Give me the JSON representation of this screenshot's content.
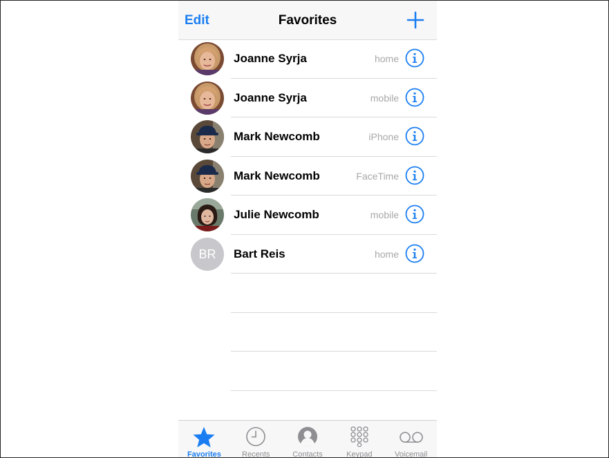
{
  "nav": {
    "edit_label": "Edit",
    "title": "Favorites",
    "add_icon": "plus-icon"
  },
  "favorites": [
    {
      "name": "Joanne Syrja",
      "label": "home",
      "avatar": "photo"
    },
    {
      "name": "Joanne Syrja",
      "label": "mobile",
      "avatar": "photo"
    },
    {
      "name": "Mark Newcomb",
      "label": "iPhone",
      "avatar": "photo"
    },
    {
      "name": "Mark Newcomb",
      "label": "FaceTime",
      "avatar": "photo"
    },
    {
      "name": "Julie Newcomb",
      "label": "mobile",
      "avatar": "photo"
    },
    {
      "name": "Bart Reis",
      "label": "home",
      "avatar": "initials",
      "initials": "BR"
    }
  ],
  "tabs": [
    {
      "label": "Favorites",
      "icon": "star-icon",
      "active": true
    },
    {
      "label": "Recents",
      "icon": "clock-icon",
      "active": false
    },
    {
      "label": "Contacts",
      "icon": "person-icon",
      "active": false
    },
    {
      "label": "Keypad",
      "icon": "keypad-icon",
      "active": false
    },
    {
      "label": "Voicemail",
      "icon": "voicemail-icon",
      "active": false
    }
  ],
  "colors": {
    "accent": "#1a7ef2",
    "secondary_text": "#a8a8a8",
    "tab_inactive": "#8e8e93"
  }
}
